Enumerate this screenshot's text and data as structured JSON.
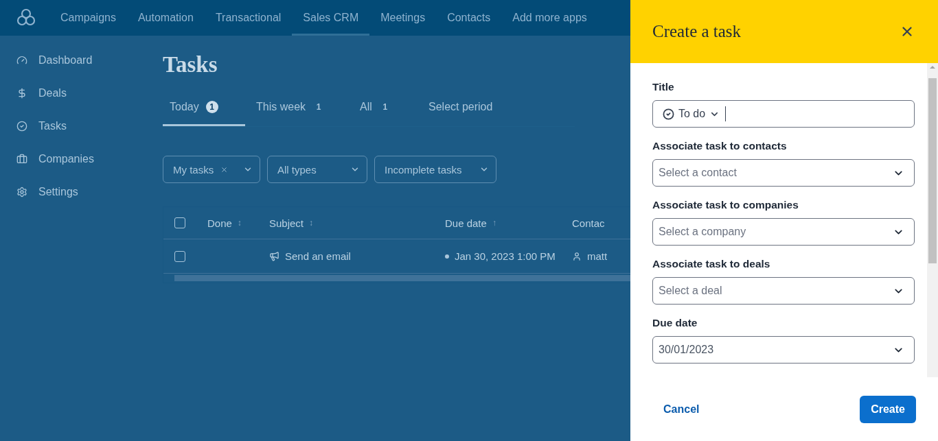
{
  "top_nav": {
    "items": [
      {
        "label": "Campaigns",
        "selected": false
      },
      {
        "label": "Automation",
        "selected": false
      },
      {
        "label": "Transactional",
        "selected": false
      },
      {
        "label": "Sales CRM",
        "selected": true
      },
      {
        "label": "Meetings",
        "selected": false
      },
      {
        "label": "Contacts",
        "selected": false
      },
      {
        "label": "Add more apps",
        "selected": false
      }
    ]
  },
  "sidebar": {
    "items": [
      {
        "label": "Dashboard",
        "kind": "dashboard"
      },
      {
        "label": "Deals",
        "kind": "deals"
      },
      {
        "label": "Tasks",
        "kind": "tasks"
      },
      {
        "label": "Companies",
        "kind": "companies"
      },
      {
        "label": "Settings",
        "kind": "settings"
      }
    ]
  },
  "page": {
    "title": "Tasks",
    "tabs": [
      {
        "label": "Today",
        "count": "1",
        "selected": true
      },
      {
        "label": "This week",
        "count": "1",
        "selected": false
      },
      {
        "label": "All",
        "count": "1",
        "selected": false
      },
      {
        "label": "Select period",
        "selected": false
      }
    ],
    "filters": [
      {
        "label": "My tasks",
        "clearable": true
      },
      {
        "label": "All types",
        "clearable": false
      },
      {
        "label": "Incomplete tasks",
        "clearable": false
      }
    ],
    "table": {
      "select_all_checked": false,
      "columns": [
        {
          "label": "Done",
          "sort": "↕"
        },
        {
          "label": "Subject",
          "sort": "↕"
        },
        {
          "label": "Due date",
          "sort": "↑"
        },
        {
          "label": "Contac"
        }
      ],
      "rows": [
        {
          "checked": false,
          "subject": "Send an email",
          "due": "Jan 30, 2023 1:00 PM",
          "contact": "matt"
        }
      ]
    }
  },
  "panel": {
    "title": "Create a task",
    "fields": [
      {
        "label": "Title",
        "kind": "title",
        "type": "To do"
      },
      {
        "label": "Associate task to contacts",
        "kind": "select",
        "placeholder": "Select a contact"
      },
      {
        "label": "Associate task to companies",
        "kind": "select",
        "placeholder": "Select a company"
      },
      {
        "label": "Associate task to deals",
        "kind": "select",
        "placeholder": "Select a deal"
      },
      {
        "label": "Due date",
        "kind": "select",
        "value": "30/01/2023"
      }
    ],
    "cancel": "Cancel",
    "submit": "Create"
  }
}
